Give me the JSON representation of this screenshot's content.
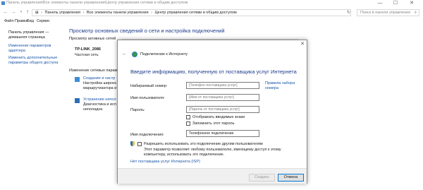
{
  "window": {
    "title": "Панель управления\\Все элементы панели управления\\Центр управления сетями и общим доступом",
    "minimize": "—",
    "maximize": "☐",
    "close": "✕"
  },
  "address": {
    "back": "←",
    "forward": "→",
    "dropdown": "▾",
    "up": "↑",
    "root_icon": "⊞",
    "crumbs": [
      "Панель управления",
      "Все элементы панели управления",
      "Центр управления сетями и общим доступом"
    ],
    "separator": "›",
    "refresh": "↻",
    "search_placeholder": "Поиск в панели управления",
    "search_icon": "⌕"
  },
  "menu": [
    "Файл",
    "Правка",
    "Вид",
    "Сервис"
  ],
  "sidebar": {
    "home": [
      "Панель управления —",
      "домашняя страница"
    ],
    "links": [
      [
        "Изменение параметров",
        "адаптера"
      ],
      [
        "Изменить дополнительные",
        "параметры общего доступа"
      ]
    ]
  },
  "main": {
    "heading": "Просмотр основных сведений о сети и настройка подключений",
    "active_networks": "Просмотр активных сетей",
    "network_name": "TP-LINK_2086",
    "network_type": "Частная сеть",
    "change_settings": "Изменение сетевых парамет",
    "tasks": [
      {
        "link": "Создание и настр",
        "desc": [
          "Настройка широкс",
          "маршрутизатора и"
        ]
      },
      {
        "link": "Устранение непол",
        "desc": [
          "Диагностика и исп",
          "неполадок."
        ]
      }
    ]
  },
  "dialog": {
    "close": "✕",
    "back": "←",
    "title": "Подключение к Интернету",
    "heading": "Введите информацию, полученную от поставщика услуг Интернета",
    "fields": {
      "phone_label": "Набираемый номер:",
      "phone_placeholder": "[Телефон поставщика услуг]",
      "user_label": "Имя пользователя:",
      "user_placeholder": "[Имя от поставщика услуг]",
      "password_label": "Пароль:",
      "password_placeholder": "[Пароль от поставщика услуг]",
      "conn_label": "Имя подключения:",
      "conn_value": "Телефонное подключение"
    },
    "isp_help": [
      "Правила набора",
      "номера"
    ],
    "show_chars": "Отображать вводимые знаки",
    "remember_password": "Запомнить этот пароль",
    "allow_others": "Разрешить использовать это подключение другим пользователям",
    "allow_note": [
      "Этот параметр позволяет любому пользователю, имеющему доступ к этому",
      "компьютеру, использовать это подключение."
    ],
    "no_isp": "Нет поставщика услуг Интернета (ISP)",
    "create": "Создать",
    "cancel": "Отмена"
  }
}
